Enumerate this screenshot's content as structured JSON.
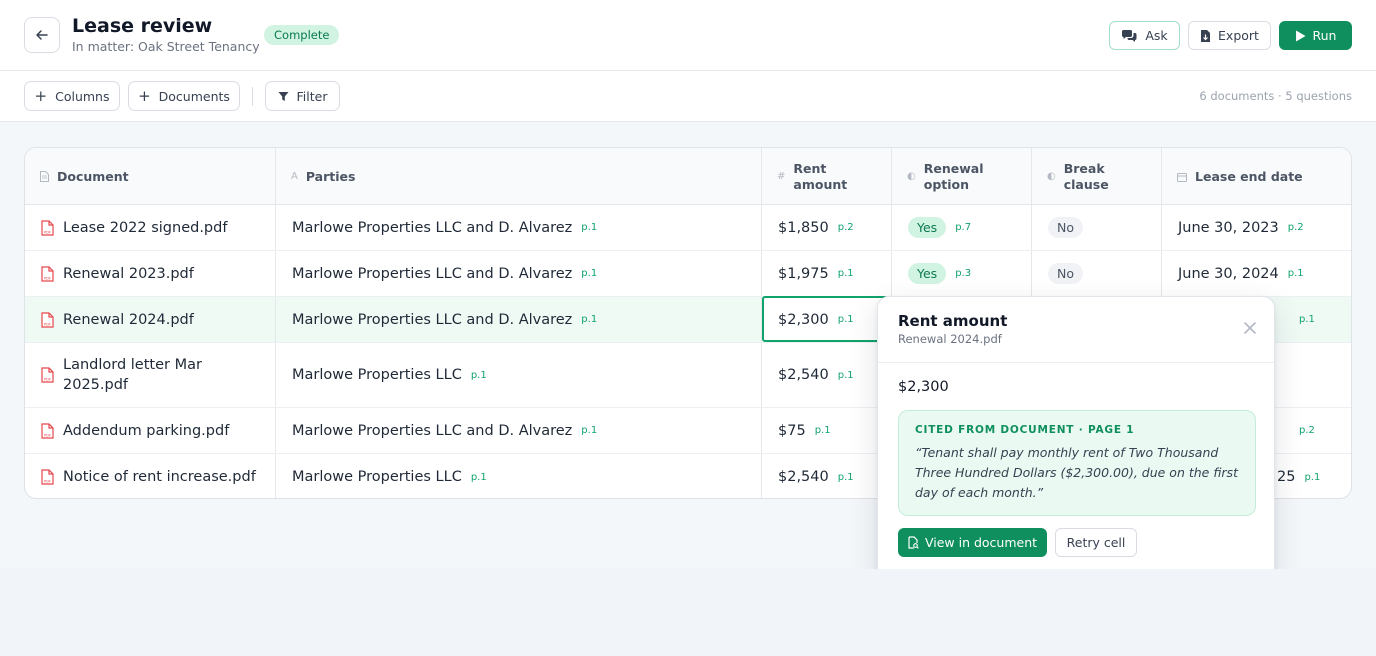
{
  "header": {
    "title": "Lease review",
    "subtitle": "In matter: Oak Street Tenancy",
    "status": "Complete",
    "actions": {
      "ask": "Ask",
      "export": "Export",
      "run": "Run"
    }
  },
  "toolbar": {
    "columns": "Columns",
    "documents": "Documents",
    "filter": "Filter",
    "summary": "6 documents · 5 questions"
  },
  "columns": [
    {
      "label": "Document",
      "icon": "file-icon",
      "type_glyph": ""
    },
    {
      "label": "Parties",
      "icon": "text-type-icon",
      "type_glyph": "A"
    },
    {
      "label": "Rent amount",
      "icon": "number-type-icon",
      "type_glyph": "#"
    },
    {
      "label": "Renewal option",
      "icon": "yes-no-type-icon",
      "type_glyph": "◐"
    },
    {
      "label": "Break clause",
      "icon": "yes-no-type-icon",
      "type_glyph": "◐"
    },
    {
      "label": "Lease end date",
      "icon": "calendar-icon",
      "type_glyph": ""
    }
  ],
  "rows": [
    {
      "document": "Lease 2022 signed.pdf",
      "parties": "Marlowe Properties LLC and D. Alvarez",
      "parties_cite": "p.1",
      "rent": "$1,850",
      "rent_cite": "p.2",
      "renewal": "Yes",
      "renewal_cite": "p.7",
      "break": "No",
      "end_date": "June 30, 2023",
      "end_cite": "p.2"
    },
    {
      "document": "Renewal 2023.pdf",
      "parties": "Marlowe Properties LLC and D. Alvarez",
      "parties_cite": "p.1",
      "rent": "$1,975",
      "rent_cite": "p.1",
      "renewal": "Yes",
      "renewal_cite": "p.3",
      "break": "No",
      "end_date": "June 30, 2024",
      "end_cite": "p.1"
    },
    {
      "document": "Renewal 2024.pdf",
      "parties": "Marlowe Properties LLC and D. Alvarez",
      "parties_cite": "p.1",
      "rent": "$2,300",
      "rent_cite": "p.1",
      "end_cite": "p.1"
    },
    {
      "document": "Landlord letter Mar 2025.pdf",
      "parties": "Marlowe Properties LLC",
      "parties_cite": "p.1",
      "rent": "$2,540",
      "rent_cite": "p.1"
    },
    {
      "document": "Addendum parking.pdf",
      "parties": "Marlowe Properties LLC and D. Alvarez",
      "parties_cite": "p.1",
      "rent": "$75",
      "rent_cite": "p.1",
      "end_cite": "p.2"
    },
    {
      "document": "Notice of rent increase.pdf",
      "parties": "Marlowe Properties LLC",
      "parties_cite": "p.1",
      "rent": "$2,540",
      "rent_cite": "p.1",
      "end_date_partial": "25",
      "end_cite": "p.1"
    }
  ],
  "popover": {
    "title": "Rent amount",
    "subtitle": "Renewal 2024.pdf",
    "value": "$2,300",
    "citation_label": "CITED FROM DOCUMENT · PAGE 1",
    "quote": "“Tenant shall pay monthly rent of Two Thousand Three Hundred Dollars ($2,300.00), due on the first day of each month.”",
    "view_button": "View in document",
    "retry_button": "Retry cell"
  },
  "colors": {
    "accent": "#0e8f5d",
    "accent_light": "#d1f3e2",
    "cite_green": "#10a36b",
    "pdf_red": "#e5484d"
  }
}
